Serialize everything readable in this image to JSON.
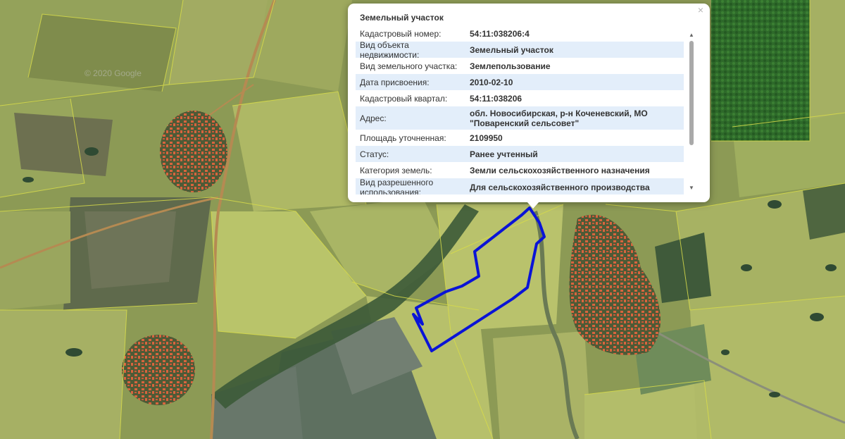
{
  "map": {
    "watermark": "© 2020 Google"
  },
  "popup": {
    "title": "Земельный участок",
    "close_label": "×",
    "rows": [
      {
        "key": "Кадастровый номер:",
        "value": "54:11:038206:4"
      },
      {
        "key": "Вид объекта недвижимости:",
        "value": "Земельный участок"
      },
      {
        "key": "Вид земельного участка:",
        "value": "Землепользование"
      },
      {
        "key": "Дата присвоения:",
        "value": "2010-02-10"
      },
      {
        "key": "Кадастровый квартал:",
        "value": "54:11:038206"
      },
      {
        "key": "Адрес:",
        "value": "обл. Новосибирская, р-н Коченевский, МО \"Поваренский сельсовет\""
      },
      {
        "key": "Площадь уточненная:",
        "value": "2109950"
      },
      {
        "key": "Статус:",
        "value": "Ранее учтенный"
      },
      {
        "key": "Категория земель:",
        "value": "Земли сельскохозяйственного назначения"
      },
      {
        "key": "Вид разрешенного использования:",
        "value": "Для сельскохозяйственного производства"
      }
    ],
    "scroll_up_glyph": "▲",
    "scroll_down_glyph": "▼"
  },
  "colors": {
    "parcel_outline": "#0a14d6",
    "parcel_boundary": "#d8dc4a",
    "settlement_roofs": "#d9643e",
    "row_highlight": "#e3eefa"
  }
}
